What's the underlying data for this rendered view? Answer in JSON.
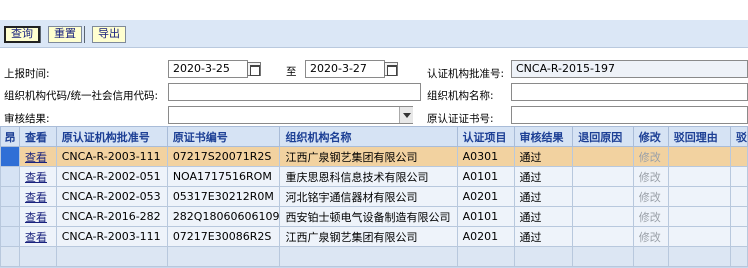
{
  "toolbar": {
    "query_label": "查询",
    "reset_label": "重置",
    "export_label": "导出"
  },
  "form": {
    "report_time_label": "上报时间:",
    "date_from": "2020-3-25",
    "to_label": "至",
    "date_to": "2020-3-27",
    "approval_no_label": "认证机构批准号:",
    "approval_no_value": "CNCA-R-2015-197",
    "org_code_label": "组织机构代码/统一社会信用代码:",
    "org_code_value": "",
    "org_name_label": "组织机构名称:",
    "org_name_value": "",
    "review_result_label": "审核结果:",
    "review_result_value": "",
    "cert_no_label": "原认证证书号:",
    "cert_no_value": ""
  },
  "grid": {
    "columns": [
      "昂",
      "查看",
      "原认证机构批准号",
      "原证书编号",
      "组织机构名称",
      "认证项目",
      "审核结果",
      "退回原因",
      "修改",
      "驳回理由",
      "驳"
    ],
    "rows": [
      {
        "view": "查看",
        "approval": "CNCA-R-2003-111",
        "cert": "07217S20071R2S",
        "org": "江西广泉钢艺集团有限公司",
        "item": "A0301",
        "result": "通过",
        "reason": "",
        "edit": "修改",
        "reject": ""
      },
      {
        "view": "查看",
        "approval": "CNCA-R-2002-051",
        "cert": "NOA1717516ROM",
        "org": "重庆思恩科信息技术有限公司",
        "item": "A0101",
        "result": "通过",
        "reason": "",
        "edit": "修改",
        "reject": ""
      },
      {
        "view": "查看",
        "approval": "CNCA-R-2002-053",
        "cert": "05317E30212R0M",
        "org": "河北铭宇通信器材有限公司",
        "item": "A0201",
        "result": "通过",
        "reason": "",
        "edit": "修改",
        "reject": ""
      },
      {
        "view": "查看",
        "approval": "CNCA-R-2016-282",
        "cert": "282Q18060606109",
        "org": "西安铂士顿电气设备制造有限公司",
        "item": "A0101",
        "result": "通过",
        "reason": "",
        "edit": "修改",
        "reject": ""
      },
      {
        "view": "查看",
        "approval": "CNCA-R-2003-111",
        "cert": "07217E30086R2S",
        "org": "江西广泉钢艺集团有限公司",
        "item": "A0201",
        "result": "通过",
        "reason": "",
        "edit": "修改",
        "reject": ""
      }
    ]
  },
  "colors": {
    "toolbar_bg": "#dbe7f6",
    "button_bg": "#ffffd0",
    "selected_row": "#f2d2a0",
    "header_text": "#1c3f95",
    "selected_marker": "#2f6fd6"
  }
}
